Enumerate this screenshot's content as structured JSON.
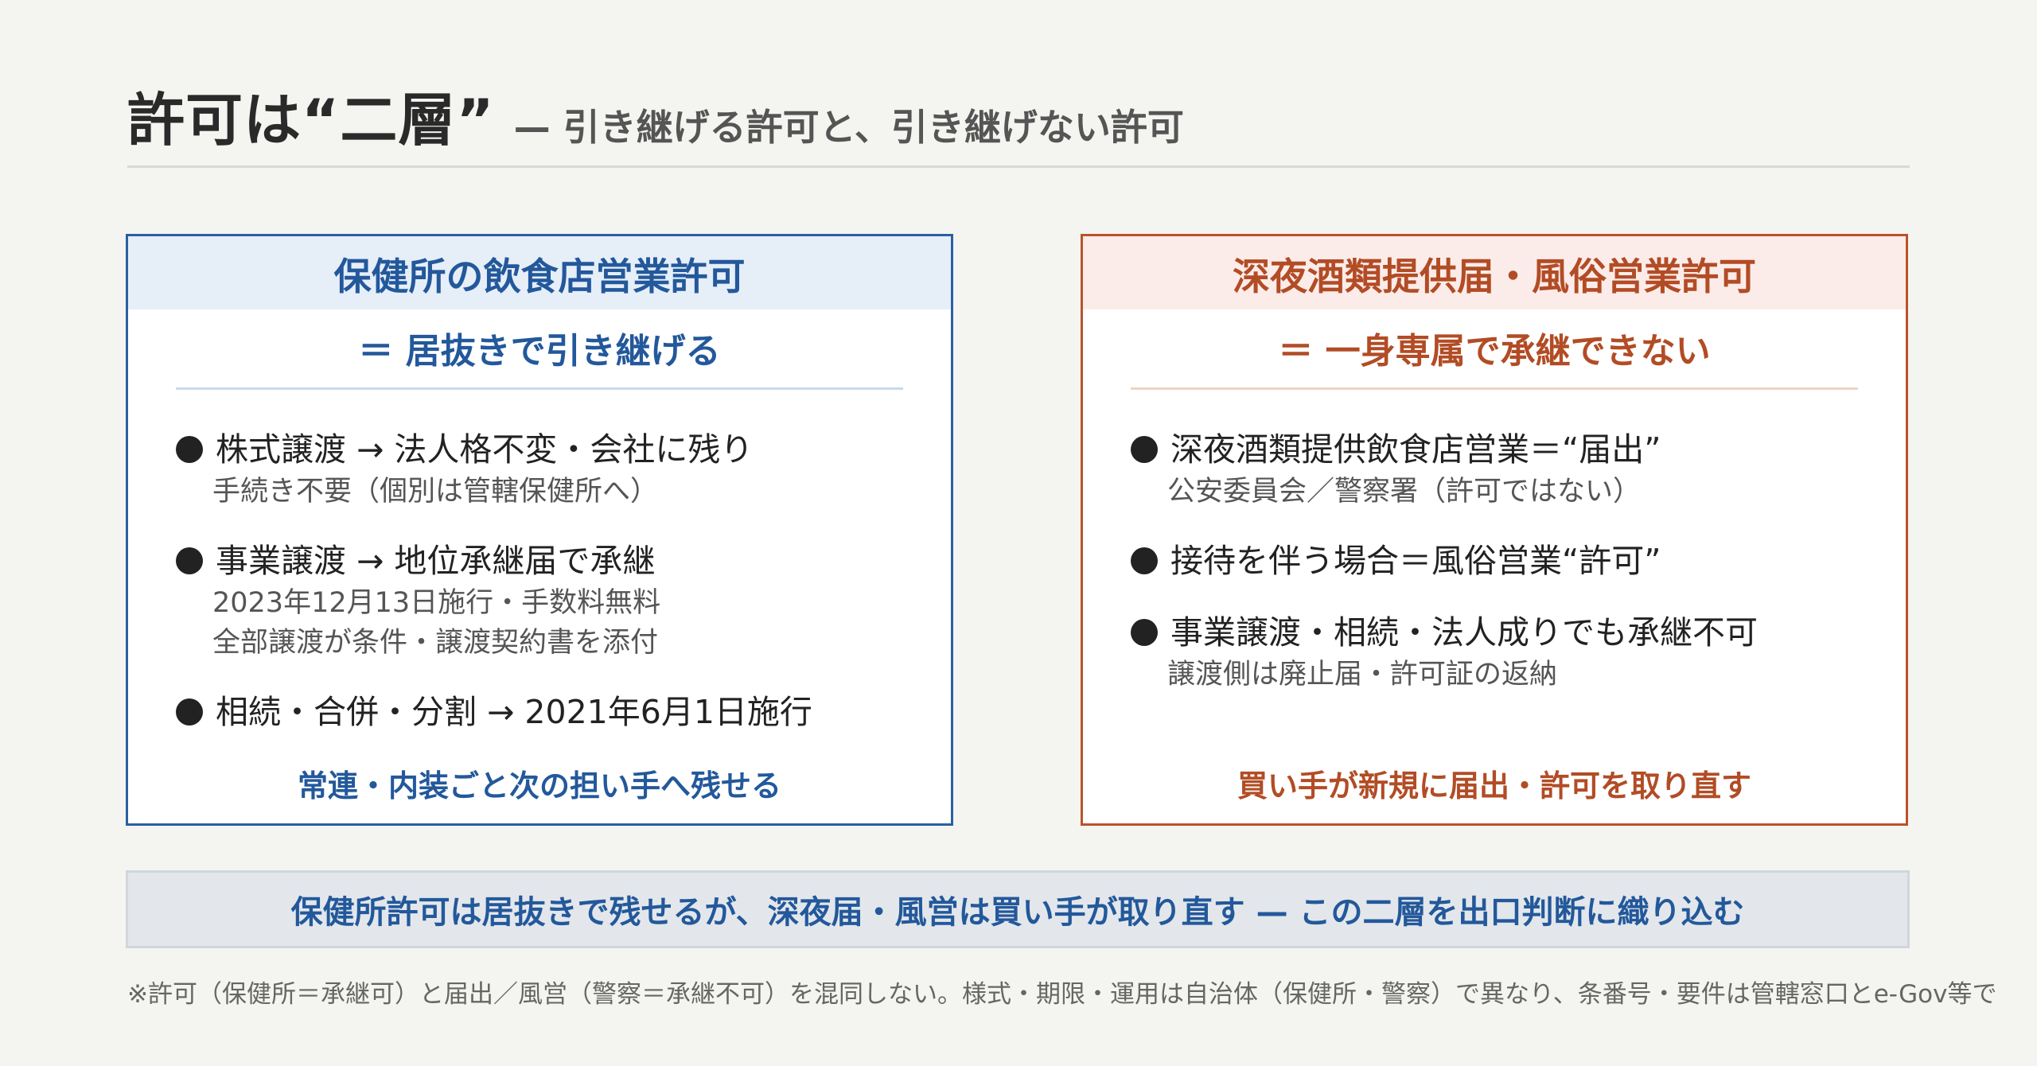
{
  "header": {
    "title": "許可は“二層”",
    "subtitle": "— 引き継げる許可と、引き継げない許可"
  },
  "left_card": {
    "heading": "保健所の飲食店営業許可",
    "subheading": "＝ 居抜きで引き継げる",
    "items": [
      {
        "main": "株式譲渡 → 法人格不変・会社に残り",
        "notes": [
          "手続き不要（個別は管轄保健所へ）"
        ]
      },
      {
        "main": "事業譲渡 → 地位承継届で承継",
        "notes": [
          "2023年12月13日施行・手数料無料",
          "全部譲渡が条件・譲渡契約書を添付"
        ]
      },
      {
        "main": "相続・合併・分割 → 2021年6月1日施行",
        "notes": []
      }
    ],
    "footer": "常連・内装ごと次の担い手へ残せる"
  },
  "right_card": {
    "heading": "深夜酒類提供届・風俗営業許可",
    "subheading": "＝ 一身専属で承継できない",
    "items": [
      {
        "main": "深夜酒類提供飲食店営業＝“届出”",
        "notes": [
          "公安委員会／警察署（許可ではない）"
        ]
      },
      {
        "main": "接待を伴う場合＝風俗営業“許可”",
        "notes": []
      },
      {
        "main": "事業譲渡・相続・法人成りでも承継不可",
        "notes": [
          "譲渡側は廃止届・許可証の返納"
        ]
      }
    ],
    "footer": "買い手が新規に届出・許可を取り直す"
  },
  "banner": {
    "text": "保健所許可は居抜きで残せるが、深夜届・風営は買い手が取り直す — この二層を出口判断に織り込む"
  },
  "footnote": {
    "text": "※許可（保健所＝承継可）と届出／風営（警察＝承継不可）を混同しない。様式・期限・運用は自治体（保健所・警察）で異なり、条番号・要件は管轄窓口とe-Gov等で"
  },
  "colors": {
    "left_accent": "#2a5fa3",
    "right_accent": "#b9532a",
    "background": "#f4f4f0"
  }
}
